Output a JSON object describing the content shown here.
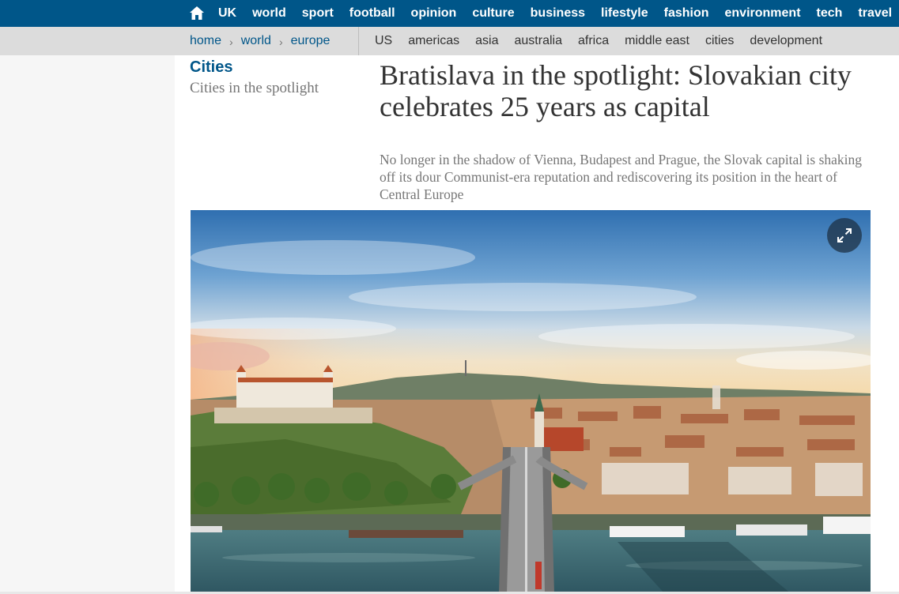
{
  "top_nav": {
    "home_icon": "home-icon",
    "items": [
      "UK",
      "world",
      "sport",
      "football",
      "opinion",
      "culture",
      "business",
      "lifestyle",
      "fashion",
      "environment",
      "tech",
      "travel"
    ]
  },
  "sub_nav": {
    "breadcrumb": [
      "home",
      "world",
      "europe"
    ],
    "separator": "›",
    "regions": [
      "US",
      "americas",
      "asia",
      "australia",
      "africa",
      "middle east",
      "cities",
      "development"
    ]
  },
  "article": {
    "section": "Cities",
    "series": "Cities in the spotlight",
    "headline": "Bratislava in the spotlight: Slovakian city celebrates 25 years as capital",
    "standfirst": "No longer in the shadow of Vienna, Budapest and Prague, the Slovak capital is shaking off its dour Communist-era reputation and rediscovering its position in the heart of Central Europe",
    "image": {
      "expand_icon": "expand-icon"
    }
  },
  "colors": {
    "brand_blue": "#005689",
    "subnav_bg": "#dcdcdc",
    "headline_text": "#333333",
    "muted_text": "#767676"
  }
}
